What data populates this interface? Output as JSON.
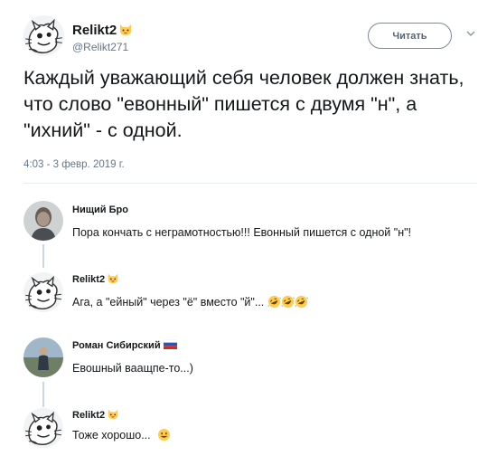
{
  "tweet": {
    "author": {
      "name": "Relikt2",
      "handle": "@Relikt271",
      "name_emoji": "cat-face-icon"
    },
    "follow_label": "Читать",
    "text": "Каждый уважающий себя человек должен знать, что слово \"евонный\" пишется с двумя \"н\", а \"ихний\" - с одной.",
    "timestamp": "4:03 - 3 февр. 2019 г."
  },
  "replies": [
    {
      "name": "Нищий Бро",
      "text": "Пора кончать с неграмотностью!!! Евонный пишется с одной \"н\"!"
    },
    {
      "name": "Relikt2",
      "text": "Ага, а \"ейный\" через \"ё\" вместо \"й\"...",
      "emoji": [
        "rolling-laughing-icon",
        "rolling-laughing-icon",
        "rolling-laughing-icon"
      ]
    },
    {
      "name": "Роман Сибирский",
      "text": "Евошный ваащпе-то...)",
      "name_emoji": "russia-flag-icon"
    },
    {
      "name": "Relikt2",
      "text": "Тоже хорошо...",
      "emoji": [
        "grinning-face-icon"
      ]
    }
  ],
  "colors": {
    "text": "#14171a",
    "muted": "#657786",
    "divider": "#e6ecf0",
    "thread": "#ccd6dd"
  }
}
